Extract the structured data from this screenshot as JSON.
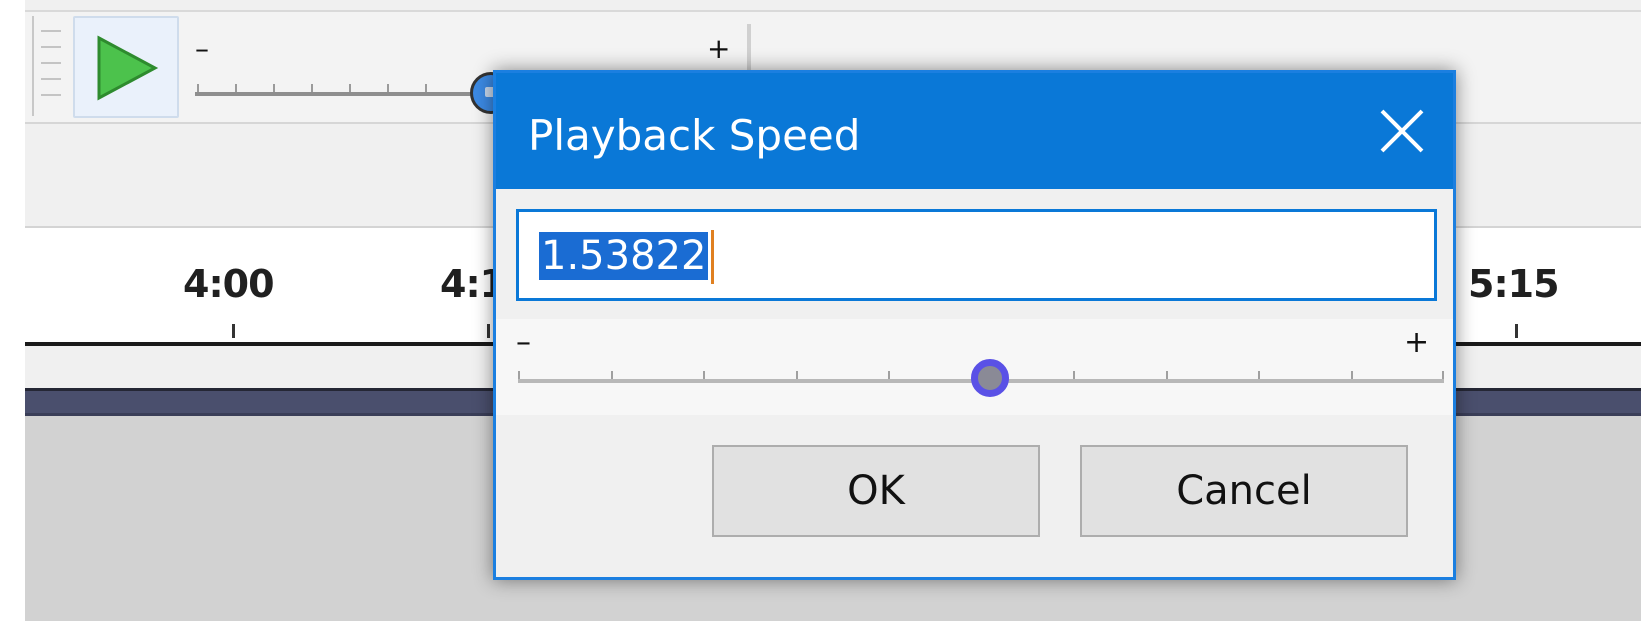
{
  "toolbar": {
    "play_icon": "play-icon",
    "slider_minus": "–",
    "slider_plus": "+",
    "slider_fraction": 0.55
  },
  "ruler": {
    "labels": [
      "4:00",
      "4:1",
      "5:15"
    ]
  },
  "dialog": {
    "title": "Playback Speed",
    "close_icon": "close-icon",
    "speed_value": "1.53822",
    "slider_minus": "–",
    "slider_plus": "+",
    "slider_fraction": 0.51,
    "ok_label": "OK",
    "cancel_label": "Cancel"
  },
  "colors": {
    "title_bar": "#0a78d7",
    "selection": "#1a6cd3",
    "slider_thumb": "#5a51e6",
    "play_green": "#4cc24c"
  }
}
